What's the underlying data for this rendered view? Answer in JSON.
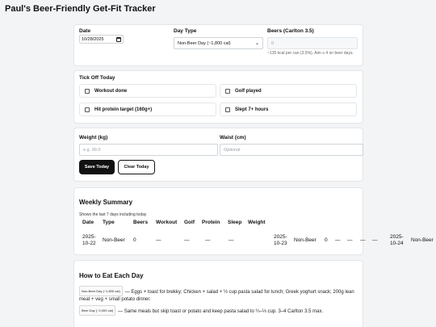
{
  "app_title": "Paul's Beer-Friendly Get-Fit Tracker",
  "entry": {
    "date_label": "Date",
    "date_value": "10/28/2025",
    "daytype_label": "Day Type",
    "daytype_value": "Non-Beer Day (~1,800 cal)",
    "beers_label": "Beers (Carlton 3.5)",
    "beers_value": "0",
    "beers_hint": "~135 kcal per can (3.5%). Aim ≤ 4 on beer days."
  },
  "tickoff": {
    "title": "Tick Off Today",
    "items": [
      "Workout done",
      "Golf played",
      "Hit protein target (160g+)",
      "Slept 7+ hours"
    ]
  },
  "measure": {
    "weight_label": "Weight (kg)",
    "weight_placeholder": "e.g. 90.0",
    "waist_label": "Waist (cm)",
    "waist_placeholder": "Optional",
    "save_label": "Save Today",
    "clear_label": "Clear Today"
  },
  "weekly": {
    "title": "Weekly Summary",
    "note": "Shows the last 7 days including today",
    "headers": [
      "Date",
      "Type",
      "Beers",
      "Workout",
      "Golf",
      "Protein",
      "Sleep",
      "Weight"
    ],
    "rows": [
      {
        "date_a": "2025-",
        "date_b": "10-22",
        "type": "Non-Beer",
        "beers": "0",
        "workout": "—",
        "golf": "—",
        "protein": "—",
        "sleep": "—"
      },
      {
        "date_a": "2025-",
        "date_b": "10-23",
        "type": "Non-Beer",
        "beers": "0",
        "workout": "—",
        "golf": "—",
        "protein": "—",
        "sleep": "—"
      },
      {
        "date_a": "2025-",
        "date_b": "10-24",
        "type": "Non-Beer"
      }
    ]
  },
  "eat": {
    "title": "How to Eat Each Day",
    "nonbeer_tag": "Non-Beer Day (~1,800 cal)",
    "nonbeer_text": "— Eggs + toast for brekky; Chicken + salad + ½ cup pasta salad for lunch; Greek yoghurt snack; 200g lean meat + veg + small potato dinner.",
    "beer_tag": "Beer Day (~2,000 cal)",
    "beer_text": "— Same meals but skip toast or potato and keep pasta salad to ¼–⅓ cup. 3–4 Carlton 3.5 max."
  }
}
